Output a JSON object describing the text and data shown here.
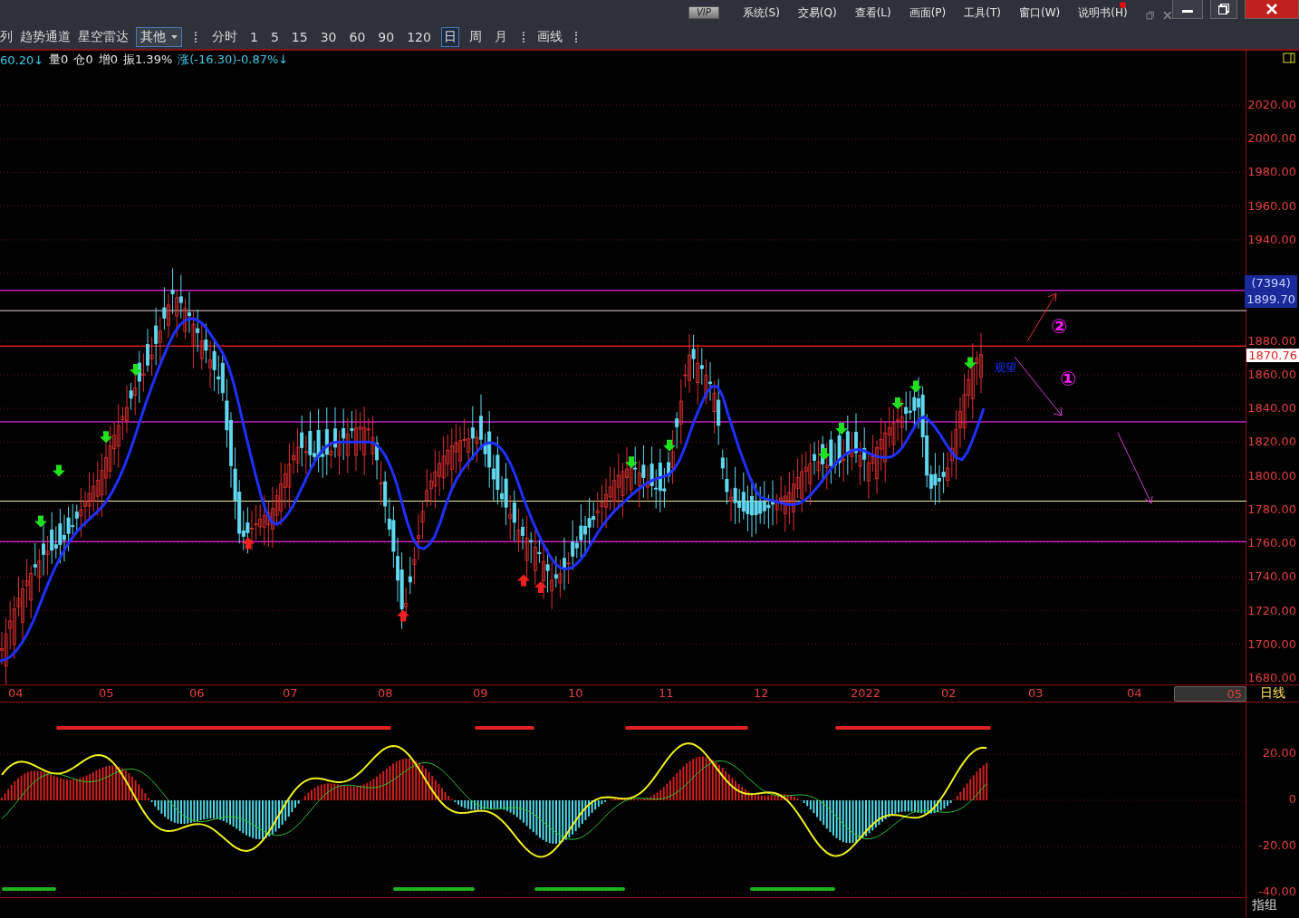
{
  "menu_bar": {
    "badge": "VIP",
    "items": [
      {
        "label": "系统(S)",
        "notice": false
      },
      {
        "label": "交易(Q)",
        "notice": false
      },
      {
        "label": "查看(L)",
        "notice": false
      },
      {
        "label": "画面(P)",
        "notice": false
      },
      {
        "label": "工具(T)",
        "notice": false
      },
      {
        "label": "窗口(W)",
        "notice": false
      },
      {
        "label": "说明书(H)",
        "notice": true
      }
    ]
  },
  "toolbar": {
    "tools": [
      "列",
      "趋势通道",
      "星空雷达"
    ],
    "dropdown": {
      "value": "其他"
    },
    "periods": [
      {
        "label": "分时",
        "selected": false
      },
      {
        "label": "1",
        "selected": false
      },
      {
        "label": "5",
        "selected": false
      },
      {
        "label": "15",
        "selected": false
      },
      {
        "label": "30",
        "selected": false
      },
      {
        "label": "60",
        "selected": false
      },
      {
        "label": "90",
        "selected": false
      },
      {
        "label": "120",
        "selected": false
      },
      {
        "label": "日",
        "selected": true
      },
      {
        "label": "周",
        "selected": false
      },
      {
        "label": "月",
        "selected": false
      }
    ],
    "draw_tool": "画线"
  },
  "quote_info": [
    {
      "text": "60.20↓",
      "kind": "fall"
    },
    {
      "text": "量0",
      "kind": "plain"
    },
    {
      "text": "仓0",
      "kind": "plain"
    },
    {
      "text": "增0",
      "kind": "plain"
    },
    {
      "text": "振1.39%",
      "kind": "plain"
    },
    {
      "text": "涨(-16.30)-0.87%↓",
      "kind": "fall"
    }
  ],
  "price_axis": [
    "2020.00",
    "2000.00",
    "1980.00",
    "1960.00",
    "1940.00",
    "1880.00",
    "1860.00",
    "1840.00",
    "1820.00",
    "1800.00",
    "1780.00",
    "1760.00",
    "1740.00",
    "1720.00",
    "1700.00",
    "1680.00"
  ],
  "cursor_tag": {
    "count": "(7394)",
    "price": "1899.70"
  },
  "current_price": "1870.76",
  "annotations": [
    {
      "text": "②",
      "kind": "circled"
    },
    {
      "text": "①",
      "kind": "circled"
    },
    {
      "text": "观望",
      "kind": "note"
    }
  ],
  "time_axis": [
    {
      "label": "04",
      "highlighted": false
    },
    {
      "label": "05",
      "highlighted": false
    },
    {
      "label": "06",
      "highlighted": false
    },
    {
      "label": "07",
      "highlighted": false
    },
    {
      "label": "08",
      "highlighted": false
    },
    {
      "label": "09",
      "highlighted": false
    },
    {
      "label": "10",
      "highlighted": false
    },
    {
      "label": "11",
      "highlighted": false
    },
    {
      "label": "12",
      "highlighted": false
    },
    {
      "label": "2022",
      "highlighted": false
    },
    {
      "label": "02",
      "highlighted": false
    },
    {
      "label": "03",
      "highlighted": false
    },
    {
      "label": "04",
      "highlighted": false
    },
    {
      "label": "05",
      "highlighted": true
    }
  ],
  "period_label": "日线",
  "indicator_axis": [
    "20.00",
    "0",
    "-20.00",
    "-40.00"
  ],
  "indicator_group": "指组"
}
